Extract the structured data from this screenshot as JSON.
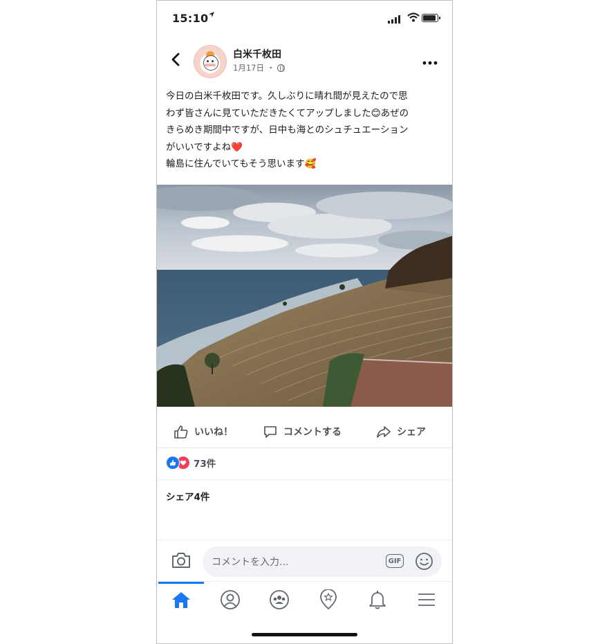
{
  "status_bar": {
    "time": "15:10"
  },
  "header": {
    "page_name": "白米千枚田",
    "date": "1月17日",
    "dot": "・",
    "icons": {
      "back": "chevron-left-icon",
      "more": "more-dots-icon",
      "privacy": "globe-icon"
    }
  },
  "post": {
    "lines": [
      "今日の白米千枚田です。久しぶりに晴れ間が見えたので思",
      "わず皆さんに見ていただきたくてアップしました😊あぜの",
      "きらめき期間中ですが、日中も海とのシュチュエーション",
      "がいいですよね❤️",
      "輪島に住んでいてもそう思います🥰"
    ]
  },
  "actions": {
    "like_label": "いいね！",
    "comment_label": "コメントする",
    "share_label": "シェア"
  },
  "stats": {
    "reactions_count": "73件",
    "shares": "シェア4件"
  },
  "comment_box": {
    "placeholder": "コメントを入力...",
    "gif_label": "GIF"
  },
  "nav": {
    "tabs": [
      "home-icon",
      "profile-icon",
      "groups-icon",
      "pages-icon",
      "bell-icon",
      "menu-icon"
    ],
    "active": "home-icon"
  },
  "colors": {
    "accent": "#1877f2",
    "love": "#f33e58",
    "text": "#1c1e21",
    "muted": "#65676b"
  }
}
